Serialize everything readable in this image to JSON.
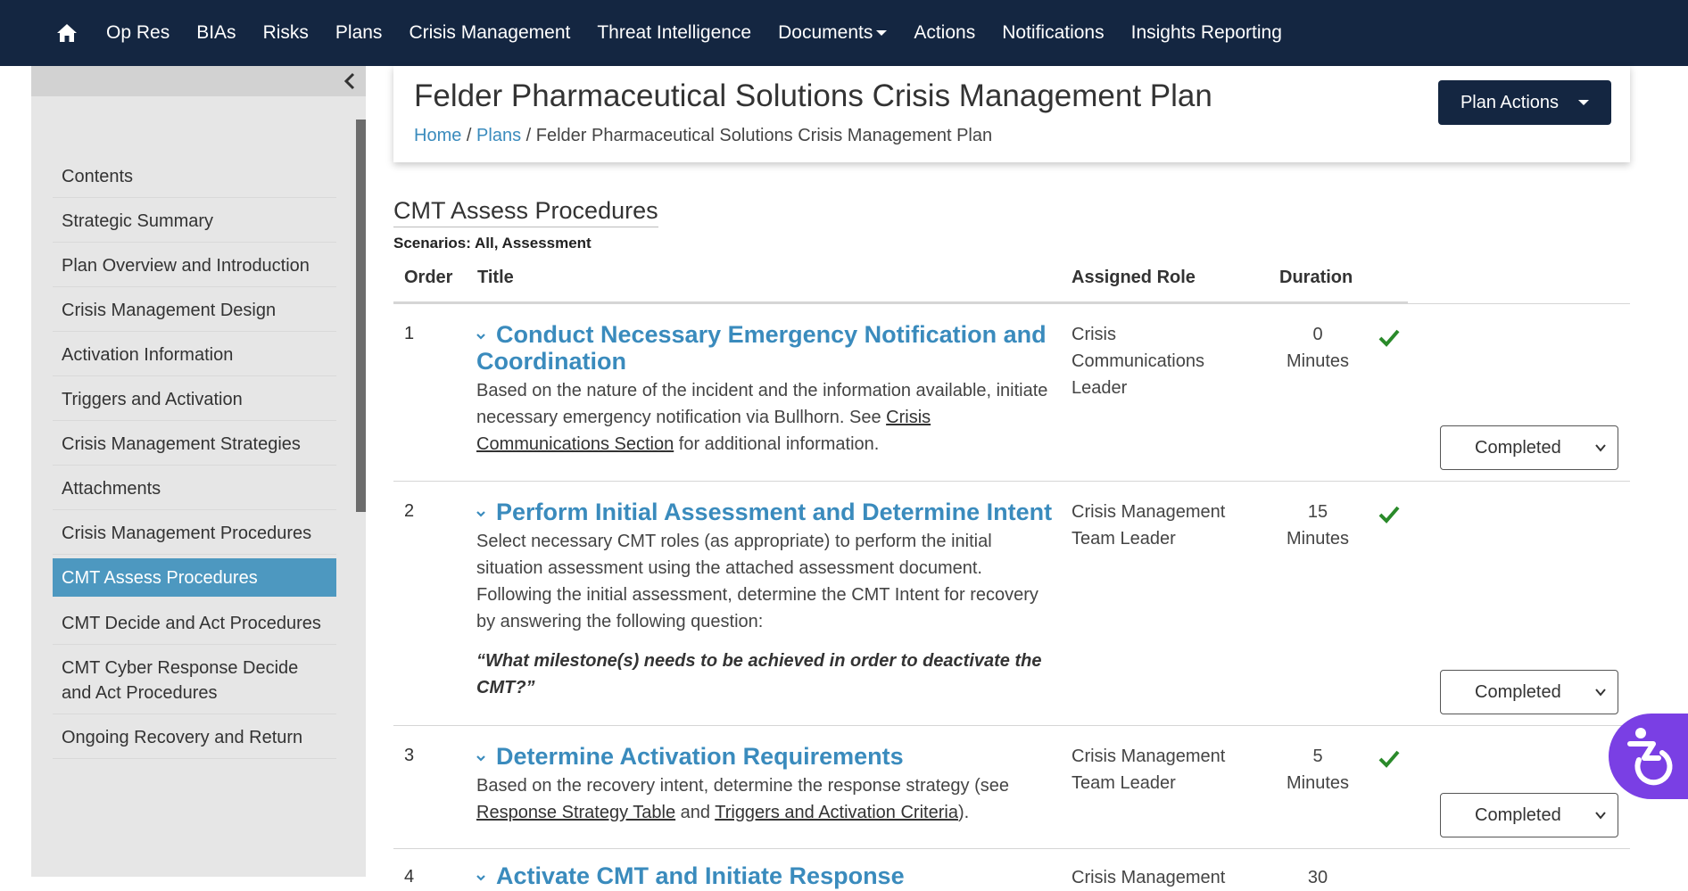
{
  "nav": {
    "items": [
      "Op Res",
      "BIAs",
      "Risks",
      "Plans",
      "Crisis Management",
      "Threat Intelligence",
      "Documents",
      "Actions",
      "Notifications",
      "Insights Reporting"
    ]
  },
  "sidebar": {
    "items": [
      "Contents",
      "Strategic Summary",
      "Plan Overview and Introduction",
      "Crisis Management Design",
      "Activation Information",
      "Triggers and Activation",
      "Crisis Management Strategies",
      "Attachments",
      "Crisis Management Procedures",
      "CMT Assess Procedures",
      "CMT Decide and Act Procedures",
      "CMT Cyber Response Decide and Act Procedures",
      "Ongoing Recovery and Return"
    ],
    "active_index": 9
  },
  "header": {
    "title": "Felder Pharmaceutical Solutions Crisis Management Plan",
    "breadcrumb": [
      "Home",
      "Plans",
      "Felder Pharmaceutical Solutions Crisis Management Plan"
    ],
    "plan_actions_label": "Plan Actions"
  },
  "section": {
    "title": "CMT Assess Procedures",
    "scenarios": "Scenarios: All, Assessment"
  },
  "table": {
    "headers": [
      "Order",
      "Title",
      "Assigned Role",
      "Duration"
    ],
    "rows": [
      {
        "order": "1",
        "title": "Conduct Necessary Emergency Notification and Coordination",
        "desc_before": "Based on the nature of the incident and the information available, initiate necessary emergency notification via Bullhorn. See ",
        "link1": "Crisis Communications Section",
        "desc_after": " for additional information.",
        "role": "Crisis Communications Leader",
        "duration_value": "0",
        "duration_unit": "Minutes",
        "status": "Completed"
      },
      {
        "order": "2",
        "title": "Perform Initial Assessment and Determine Intent",
        "desc": "Select necessary CMT roles (as appropriate) to perform the initial situation assessment using the attached assessment document. Following the initial assessment, determine the CMT Intent for recovery by answering the following question:",
        "question": "“What milestone(s) needs to be achieved in order to deactivate the CMT?”",
        "role": "Crisis Management Team Leader",
        "duration_value": "15",
        "duration_unit": "Minutes",
        "status": "Completed"
      },
      {
        "order": "3",
        "title": "Determine Activation Requirements",
        "desc_before": "Based on the recovery intent, determine the response strategy (see ",
        "link1": "Response Strategy Table",
        "desc_mid": " and ",
        "link2": "Triggers and Activation Criteria",
        "desc_after": ").",
        "role": "Crisis Management Team Leader",
        "duration_value": "5",
        "duration_unit": "Minutes",
        "status": "Completed"
      },
      {
        "order": "4",
        "title": "Activate CMT and Initiate Response",
        "role": "Crisis Management",
        "duration_value": "30"
      }
    ]
  },
  "colors": {
    "nav_bg": "#142641",
    "link": "#3a8bbd",
    "active_sidebar": "#4d98c0",
    "check": "#2a8a2a",
    "a11y": "#7a3fe4"
  }
}
